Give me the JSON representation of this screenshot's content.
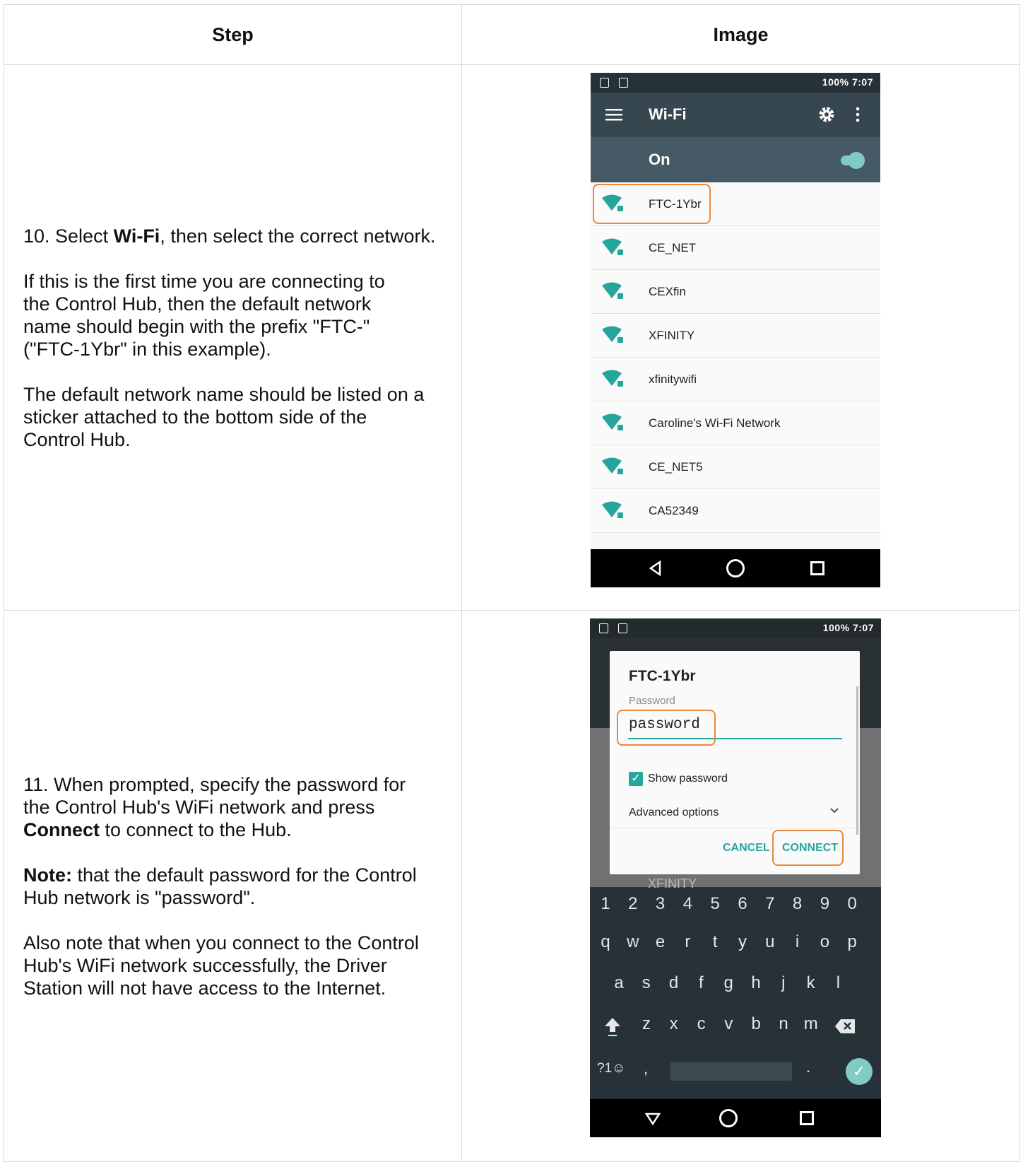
{
  "header": {
    "step": "Step",
    "image": "Image"
  },
  "rows": [
    {
      "step_paragraphs": [
        {
          "pre": "10. Select ",
          "bold": "Wi-Fi",
          "post": ", then select the correct network."
        },
        {
          "text": "If this is the first time you are connecting to the Control Hub, then the default network name should begin with the prefix \"FTC-\" (\"FTC-1Ybr\" in this example)."
        },
        {
          "text": "The default network name should be listed on a sticker attached to the bottom side of the Control Hub."
        }
      ],
      "phone": {
        "status_right": "100%  7:07",
        "appbar_title": "Wi-Fi",
        "toggle_label": "On",
        "accent": "#26a69a",
        "networks": [
          "FTC-1Ybr",
          "CE_NET",
          "CEXfin",
          "XFINITY",
          "xfinitywifi",
          "Caroline's Wi-Fi Network",
          "CE_NET5",
          "CA52349"
        ]
      }
    },
    {
      "step_paragraphs": [
        {
          "pre": "11. When prompted, specify the password for the Control Hub's WiFi network and press ",
          "bold": "Connect",
          "post": " to connect to the Hub."
        },
        {
          "bold_lead": "Note:",
          "text": " that the default password for the Control Hub network is \"password\"."
        },
        {
          "text": "Also note that when you connect to the Control Hub's WiFi network successfully, the Driver Station will not have access to the Internet."
        }
      ],
      "phone": {
        "status_right": "100%  7:07",
        "dialog_title": "FTC-1Ybr",
        "password_label": "Password",
        "password_value": "password",
        "show_password": "Show password",
        "advanced_options": "Advanced options",
        "cancel": "CANCEL",
        "connect": "CONNECT",
        "behind_text": "XFINITY",
        "keyboard": {
          "row_numbers": [
            "1",
            "2",
            "3",
            "4",
            "5",
            "6",
            "7",
            "8",
            "9",
            "0"
          ],
          "row_q": [
            "q",
            "w",
            "e",
            "r",
            "t",
            "y",
            "u",
            "i",
            "o",
            "p"
          ],
          "row_a": [
            "a",
            "s",
            "d",
            "f",
            "g",
            "h",
            "j",
            "k",
            "l"
          ],
          "row_z": [
            "z",
            "x",
            "c",
            "v",
            "b",
            "n",
            "m"
          ],
          "symbols_key": "?1☺",
          "comma": ",",
          "period": "."
        }
      }
    }
  ]
}
